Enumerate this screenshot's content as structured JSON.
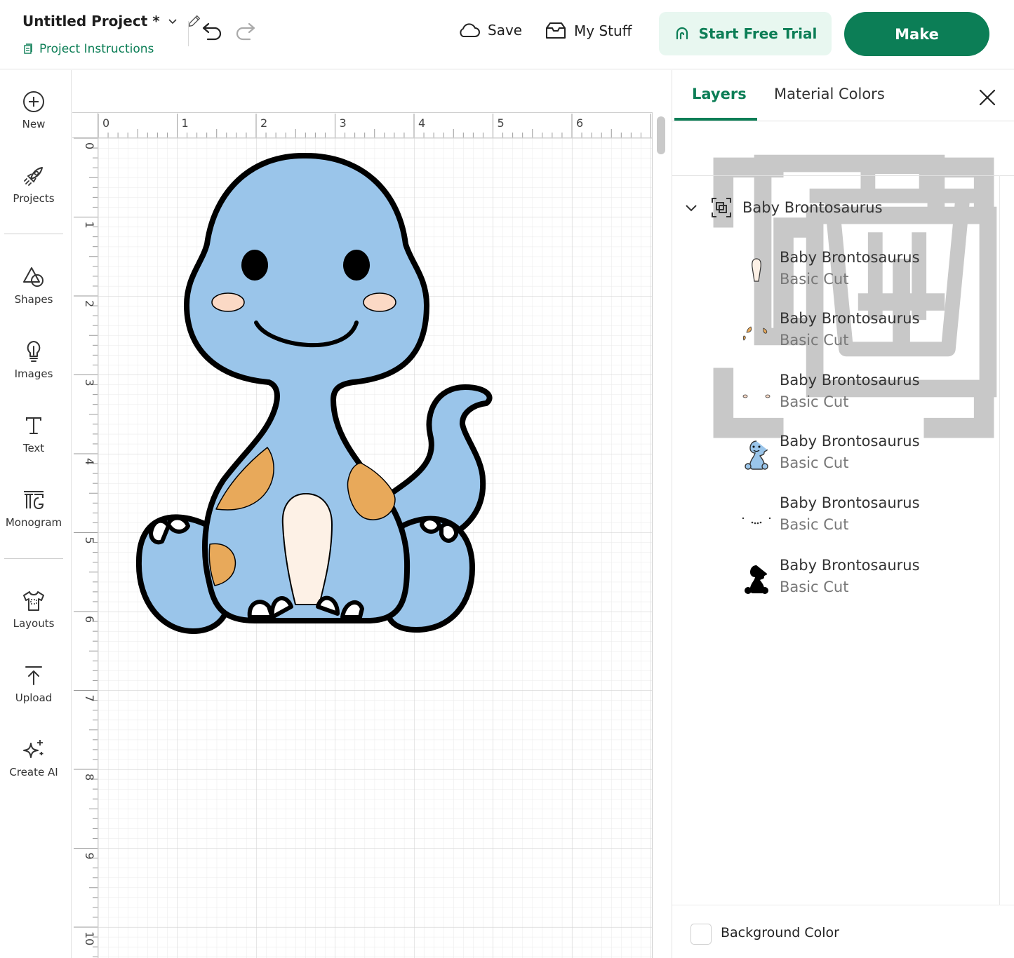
{
  "header": {
    "project_title": "Untitled Project *",
    "project_instructions": "Project Instructions",
    "save_label": "Save",
    "mystuff_label": "My Stuff",
    "trial_label": "Start Free Trial",
    "make_label": "Make"
  },
  "toolbar": {
    "items": [
      {
        "label": "New",
        "icon": "plus-circle-icon"
      },
      {
        "label": "Projects",
        "icon": "rocket-icon"
      },
      {
        "label": "Shapes",
        "icon": "shapes-icon"
      },
      {
        "label": "Images",
        "icon": "lightbulb-icon"
      },
      {
        "label": "Text",
        "icon": "text-icon"
      },
      {
        "label": "Monogram",
        "icon": "monogram-icon"
      },
      {
        "label": "Layouts",
        "icon": "shirt-icon"
      },
      {
        "label": "Upload",
        "icon": "upload-icon"
      },
      {
        "label": "Create AI",
        "icon": "sparkle-icon"
      }
    ]
  },
  "canvas": {
    "ruler_top": [
      "0",
      "1",
      "2",
      "3",
      "4",
      "5",
      "6"
    ],
    "ruler_left": [
      "0",
      "1",
      "2",
      "3",
      "4",
      "5",
      "6",
      "7",
      "8",
      "9",
      "10"
    ],
    "design_fill": "#9ac5ea",
    "spot_fill": "#e8a95a",
    "cheek_fill": "#fbd9c5",
    "belly_fill": "#fdf1e6"
  },
  "panel": {
    "tabs": [
      {
        "label": "Layers"
      },
      {
        "label": "Material Colors"
      }
    ],
    "group_name": "Baby Brontosaurus",
    "layers": [
      {
        "name": "Baby Brontosaurus",
        "type": "Basic Cut"
      },
      {
        "name": "Baby Brontosaurus",
        "type": "Basic Cut"
      },
      {
        "name": "Baby Brontosaurus",
        "type": "Basic Cut"
      },
      {
        "name": "Baby Brontosaurus",
        "type": "Basic Cut"
      },
      {
        "name": "Baby Brontosaurus",
        "type": "Basic Cut"
      },
      {
        "name": "Baby Brontosaurus",
        "type": "Basic Cut"
      }
    ],
    "background_color_label": "Background Color"
  },
  "colors": {
    "accent": "#0c7e56",
    "trial_bg": "#e8f7f0"
  }
}
